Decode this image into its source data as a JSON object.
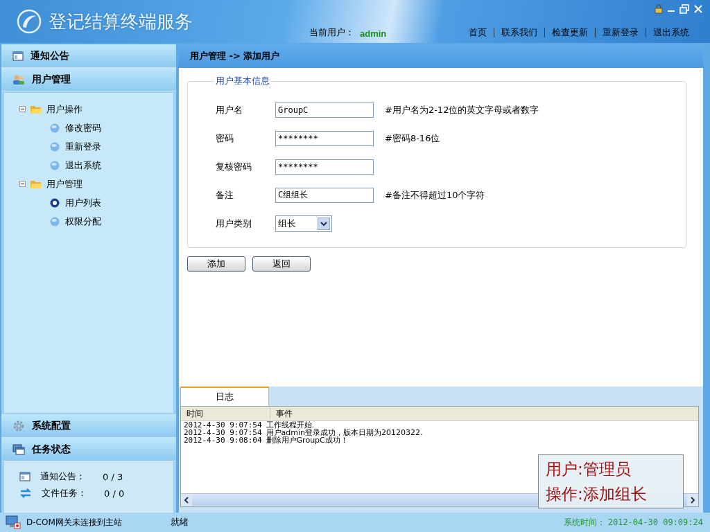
{
  "header": {
    "title": "登记结算终端服务",
    "current_user_label": "当前用户：",
    "current_user": "admin",
    "nav": [
      "首页",
      "联系我们",
      "检查更新",
      "重新登录",
      "退出系统"
    ]
  },
  "sidebar": {
    "sections": [
      {
        "title": "通知公告",
        "kind": "notice"
      },
      {
        "title": "用户管理",
        "kind": "users",
        "tree": [
          {
            "label": "用户操作",
            "expanded": true,
            "children": [
              {
                "label": "修改密码",
                "selected": false
              },
              {
                "label": "重新登录",
                "selected": false
              },
              {
                "label": "退出系统",
                "selected": false
              }
            ]
          },
          {
            "label": "用户管理",
            "expanded": true,
            "children": [
              {
                "label": "用户列表",
                "selected": true
              },
              {
                "label": "权限分配",
                "selected": false
              }
            ]
          }
        ]
      },
      {
        "title": "系统配置",
        "kind": "config"
      },
      {
        "title": "任务状态",
        "kind": "tasks",
        "stats": [
          {
            "label": "通知公告：",
            "value": "0 / 3",
            "kind": "notice"
          },
          {
            "label": "文件任务：",
            "value": "0 / 0",
            "kind": "files"
          }
        ]
      }
    ]
  },
  "breadcrumb": "用户管理 -> 添加用户",
  "form": {
    "legend": "用户基本信息",
    "fields": [
      {
        "label": "用户名",
        "kind": "text",
        "value": "GroupC",
        "hint": "#用户名为2-12位的英文字母或者数字"
      },
      {
        "label": "密码",
        "kind": "text",
        "value": "********",
        "hint": "#密码8-16位"
      },
      {
        "label": "复核密码",
        "kind": "text",
        "value": "********"
      },
      {
        "label": "备注",
        "kind": "text",
        "value": "C组组长",
        "hint": "#备注不得超过10个字符"
      },
      {
        "label": "用户类别",
        "kind": "select",
        "value": "组长"
      }
    ],
    "buttons": [
      "添加",
      "返回"
    ]
  },
  "log": {
    "tabs": [
      {
        "label": "日志",
        "selected": true
      }
    ],
    "columns": [
      "时间",
      "事件"
    ],
    "rows": [
      {
        "time": "2012-4-30 9:07:54",
        "event": "工作线程开始."
      },
      {
        "time": "2012-4-30 9:07:54",
        "event": "用户admin登录成功，版本日期为20120322."
      },
      {
        "time": "2012-4-30 9:08:04",
        "event": "删除用户GroupC成功！"
      }
    ]
  },
  "annotation": [
    "用户:管理员",
    "操作:添加组长"
  ],
  "status_bar": {
    "connection": "D-COM网关未连接到主站",
    "status": "就绪",
    "time_label": "系统时间：",
    "time": "2012-04-30 09:09:24"
  }
}
